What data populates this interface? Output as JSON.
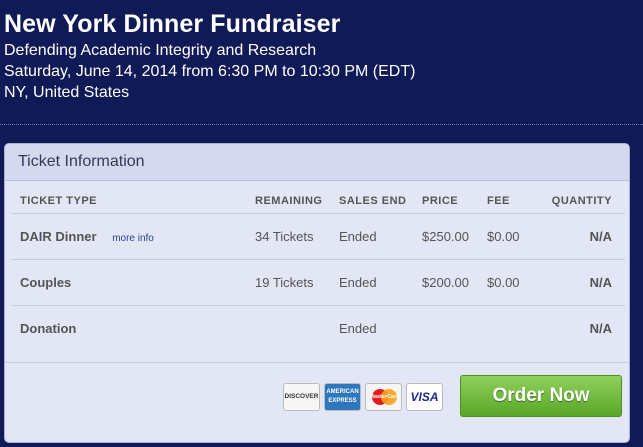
{
  "event": {
    "title": "New York Dinner Fundraiser",
    "organization": "Defending Academic Integrity and Research",
    "datetime": "Saturday, June 14, 2014 from 6:30 PM to 10:30 PM (EDT)",
    "location": "NY, United States"
  },
  "tickets": {
    "heading": "Ticket Information",
    "columns": {
      "type": "TICKET TYPE",
      "remaining": "REMAINING",
      "sales_end": "SALES END",
      "price": "PRICE",
      "fee": "FEE",
      "quantity": "QUANTITY"
    },
    "more_info_label": "more info",
    "rows": [
      {
        "type": "DAIR Dinner",
        "remaining": "34 Tickets",
        "sales_end": "Ended",
        "price": "$250.00",
        "fee": "$0.00",
        "quantity": "N/A"
      },
      {
        "type": "Couples",
        "remaining": "19 Tickets",
        "sales_end": "Ended",
        "price": "$200.00",
        "fee": "$0.00",
        "quantity": "N/A"
      },
      {
        "type": "Donation",
        "remaining": "",
        "sales_end": "Ended",
        "price": "",
        "fee": "",
        "quantity": "N/A"
      }
    ]
  },
  "payment": {
    "cards": {
      "discover": "DISCOVER",
      "amex_line1": "AMERICAN",
      "amex_line2": "EXPRESS",
      "mastercard": "MasterCard",
      "visa": "VISA"
    },
    "order_button": "Order Now"
  }
}
